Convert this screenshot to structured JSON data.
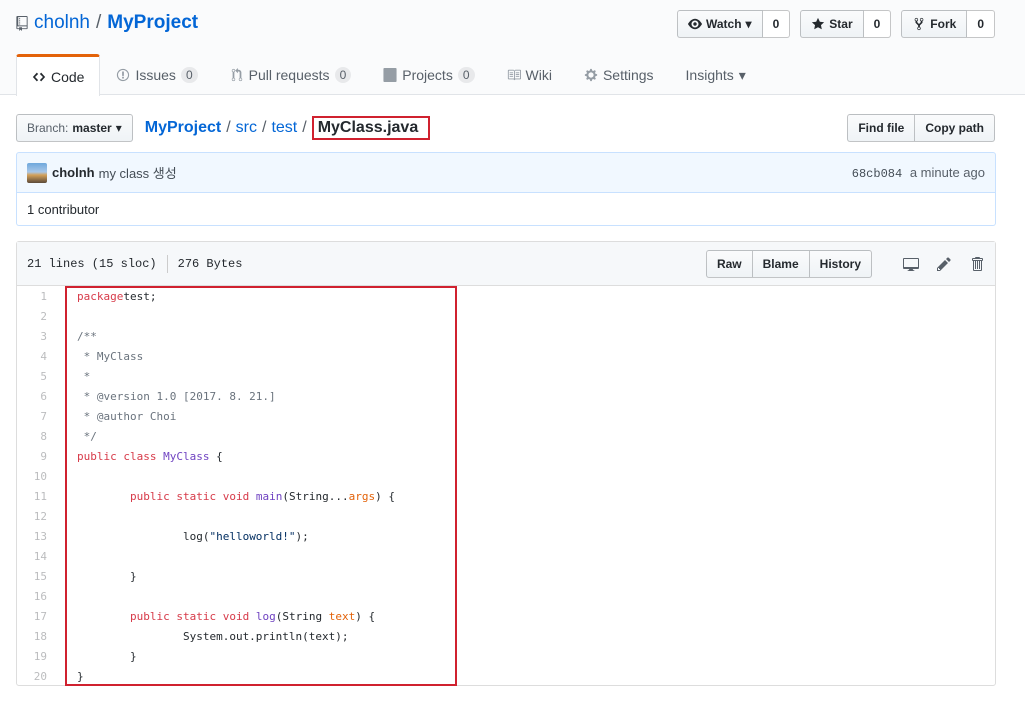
{
  "repo": {
    "owner": "cholnh",
    "separator": "/",
    "name": "MyProject"
  },
  "actions": {
    "watch": {
      "label": "Watch",
      "count": "0"
    },
    "star": {
      "label": "Star",
      "count": "0"
    },
    "fork": {
      "label": "Fork",
      "count": "0"
    }
  },
  "nav": {
    "code": "Code",
    "issues": {
      "label": "Issues",
      "count": "0"
    },
    "pulls": {
      "label": "Pull requests",
      "count": "0"
    },
    "projects": {
      "label": "Projects",
      "count": "0"
    },
    "wiki": "Wiki",
    "settings": "Settings",
    "insights": "Insights"
  },
  "file_nav": {
    "branch_label": "Branch:",
    "branch": "master",
    "path": [
      "MyProject",
      "src",
      "test"
    ],
    "filename": "MyClass.java",
    "find_file": "Find file",
    "copy_path": "Copy path"
  },
  "commit": {
    "author": "cholnh",
    "message": "my class 생성",
    "sha": "68cb084",
    "time": "a minute ago",
    "contributors": "1 contributor"
  },
  "file": {
    "lines_info": "21 lines (15 sloc)",
    "size": "276 Bytes",
    "raw": "Raw",
    "blame": "Blame",
    "history": "History"
  },
  "code": [
    [
      [
        "k",
        "package"
      ],
      [
        "",
        "test;"
      ]
    ],
    [],
    [
      [
        "c",
        "/**"
      ]
    ],
    [
      [
        "c",
        " * MyClass"
      ]
    ],
    [
      [
        "c",
        " *"
      ]
    ],
    [
      [
        "c",
        " * @version 1.0 [2017. 8. 21.]"
      ]
    ],
    [
      [
        "c",
        " * @author Choi"
      ]
    ],
    [
      [
        "c",
        " */"
      ]
    ],
    [
      [
        "k",
        "public"
      ],
      [
        "",
        " "
      ],
      [
        "k",
        "class"
      ],
      [
        "",
        " "
      ],
      [
        "e",
        "MyClass"
      ],
      [
        "",
        " {"
      ]
    ],
    [],
    [
      [
        "",
        "        "
      ],
      [
        "k",
        "public"
      ],
      [
        "",
        " "
      ],
      [
        "k",
        "static"
      ],
      [
        "",
        " "
      ],
      [
        "k",
        "void"
      ],
      [
        "",
        " "
      ],
      [
        "e",
        "main"
      ],
      [
        "",
        "(String..."
      ],
      [
        "v",
        "args"
      ],
      [
        "",
        ") {"
      ]
    ],
    [],
    [
      [
        "",
        "                log("
      ],
      [
        "s",
        "\"helloworld!\""
      ],
      [
        "",
        ");"
      ]
    ],
    [],
    [
      [
        "",
        "        }"
      ]
    ],
    [],
    [
      [
        "",
        "        "
      ],
      [
        "k",
        "public"
      ],
      [
        "",
        " "
      ],
      [
        "k",
        "static"
      ],
      [
        "",
        " "
      ],
      [
        "k",
        "void"
      ],
      [
        "",
        " "
      ],
      [
        "e",
        "log"
      ],
      [
        "",
        "(String "
      ],
      [
        "v",
        "text"
      ],
      [
        "",
        ") {"
      ]
    ],
    [
      [
        "",
        "                System.out.println(text);"
      ]
    ],
    [
      [
        "",
        "        }"
      ]
    ],
    [
      [
        "",
        "}"
      ]
    ]
  ]
}
